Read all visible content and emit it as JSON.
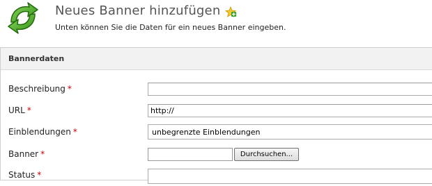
{
  "header": {
    "title": "Neues Banner hinzufügen",
    "subtitle": "Unten können Sie die Daten für ein neues Banner eingeben.",
    "app_icon": "green-recycle-arrows-icon",
    "title_icon": "star-plus-icon"
  },
  "panel": {
    "title": "Bannerdaten"
  },
  "form": {
    "required_marker": "*",
    "beschreibung": {
      "label": "Beschreibung",
      "value": ""
    },
    "url": {
      "label": "URL",
      "value": "http://"
    },
    "einblendungen": {
      "label": "Einblendungen",
      "value": "unbegrenzte Einblendungen"
    },
    "banner": {
      "label": "Banner",
      "value": "",
      "browse_label": "Durchsuchen..."
    },
    "status": {
      "label": "Status"
    }
  },
  "colors": {
    "required": "#cc0000",
    "icon_green": "#3c9d1e",
    "panel_header_bg": "#f2f2f2"
  }
}
